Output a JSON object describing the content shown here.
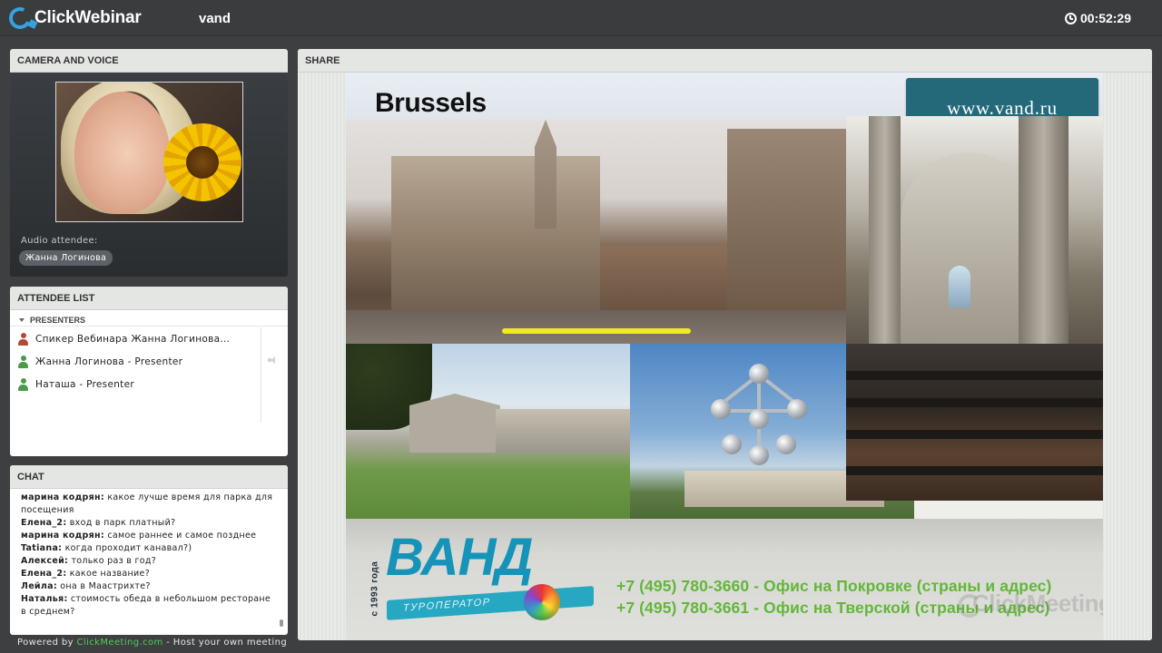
{
  "app": {
    "brand": "ClickWebinar",
    "room_name": "vand",
    "timer": "00:52:29"
  },
  "camera_panel": {
    "title": "CAMERA AND VOICE",
    "audio_label": "Audio attendee:",
    "audio_attendee": "Жанна Логинова"
  },
  "attendee_panel": {
    "title": "ATTENDEE LIST",
    "group": "PRESENTERS",
    "attendees": [
      {
        "name": "Спикер Вебинара Жанна Логинова...",
        "color": "#b14a3a"
      },
      {
        "name": "Жанна Логинова - Presenter",
        "color": "#4a9a48"
      },
      {
        "name": "Наташа - Presenter",
        "color": "#4a9a48"
      }
    ]
  },
  "chat_panel": {
    "title": "CHAT",
    "messages": [
      {
        "author": "марина кодрян:",
        "text": " какое лучше время для парка для"
      },
      {
        "author": "",
        "text": "посещения"
      },
      {
        "author": "Елена_2:",
        "text": " вход в парк платный?"
      },
      {
        "author": "марина кодрян:",
        "text": " самое раннее и самое позднее"
      },
      {
        "author": "Tatiana:",
        "text": " когда проходит канавал?)"
      },
      {
        "author": "Алексей:",
        "text": " только раз в год?"
      },
      {
        "author": "Елена_2:",
        "text": " какое название?"
      },
      {
        "author": "Лейла:",
        "text": " она в Маастрихте?"
      },
      {
        "author": "Наталья:",
        "text": " стоимость обеда в небольшом ресторане"
      },
      {
        "author": "",
        "text": "в среднем?"
      }
    ]
  },
  "footer": {
    "prefix": "Powered by ",
    "link": "ClickMeeting.com",
    "suffix": " - Host your own meeting"
  },
  "share_panel": {
    "title": "SHARE",
    "slide": {
      "title": "Brussels",
      "url": "www.vand.ru",
      "logo_text": "ВАНД",
      "logo_ribbon": "ТУРОПЕРАТОР",
      "since": "с 1993 года",
      "phone_lines": [
        "+7 (495) 780-3660 - Офис на Покровке  (страны и адрес)",
        "+7 (495) 780-3661 - Офис на Тверской   (страны и адрес)"
      ],
      "watermark": "ClickMeeting"
    }
  }
}
